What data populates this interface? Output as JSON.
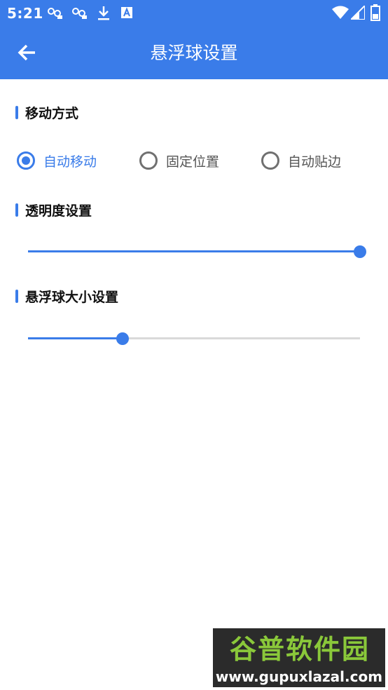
{
  "status_bar": {
    "time": "5:21",
    "icons": [
      "notification-app-icon",
      "notification-app-icon",
      "download-icon",
      "accessibility-a-icon",
      "wifi-icon",
      "signal-icon",
      "battery-icon"
    ]
  },
  "toolbar": {
    "back_icon": "arrow-left-icon",
    "title": "悬浮球设置"
  },
  "sections": {
    "move_mode": {
      "title": "移动方式",
      "options": [
        "自动移动",
        "固定位置",
        "自动贴边"
      ],
      "selected_index": 0
    },
    "opacity": {
      "title": "透明度设置",
      "value_fraction": 1.0
    },
    "ball_size": {
      "title": "悬浮球大小设置",
      "value_fraction": 0.285
    }
  },
  "colors": {
    "accent": "#3a7ce9",
    "track": "#d9d9d9",
    "unchecked": "#707070"
  },
  "watermark": {
    "logo_text": "谷普软件园",
    "url": "www.gupuxlazal.com"
  }
}
